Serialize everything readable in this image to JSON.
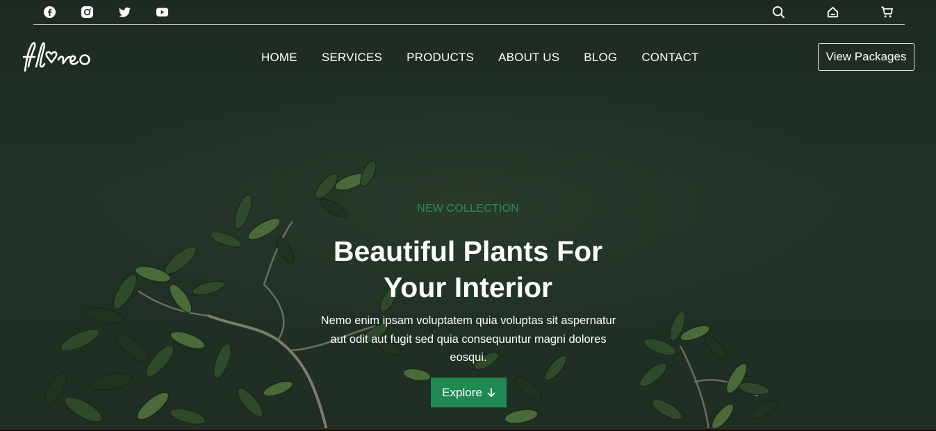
{
  "topbar": {
    "social_icons": [
      "facebook-icon",
      "instagram-icon",
      "twitter-icon",
      "youtube-icon"
    ],
    "utility_icons": [
      "search-icon",
      "home-icon",
      "cart-icon"
    ]
  },
  "brand": {
    "logo_text": "floreo"
  },
  "nav": {
    "items": [
      {
        "label": "HOME"
      },
      {
        "label": "SERVICES"
      },
      {
        "label": "PRODUCTS"
      },
      {
        "label": "ABOUT US"
      },
      {
        "label": "BLOG"
      },
      {
        "label": "CONTACT"
      }
    ],
    "cta_label": "View Packages"
  },
  "hero": {
    "kicker": "NEW COLLECTION",
    "title_line1": "Beautiful Plants For",
    "title_line2": "Your Interior",
    "description_line1": "Nemo enim ipsam voluptatem quia voluptas sit aspernatur",
    "description_line2": "aut odit aut fugit sed quia consequuntur magni dolores",
    "description_line3": "eosqui.",
    "button_label": "Explore",
    "button_icon": "arrow-down-icon"
  },
  "colors": {
    "accent_green": "#1e8a52",
    "kicker_green": "#2e8b57",
    "background": "#223126",
    "text": "#ffffff"
  }
}
